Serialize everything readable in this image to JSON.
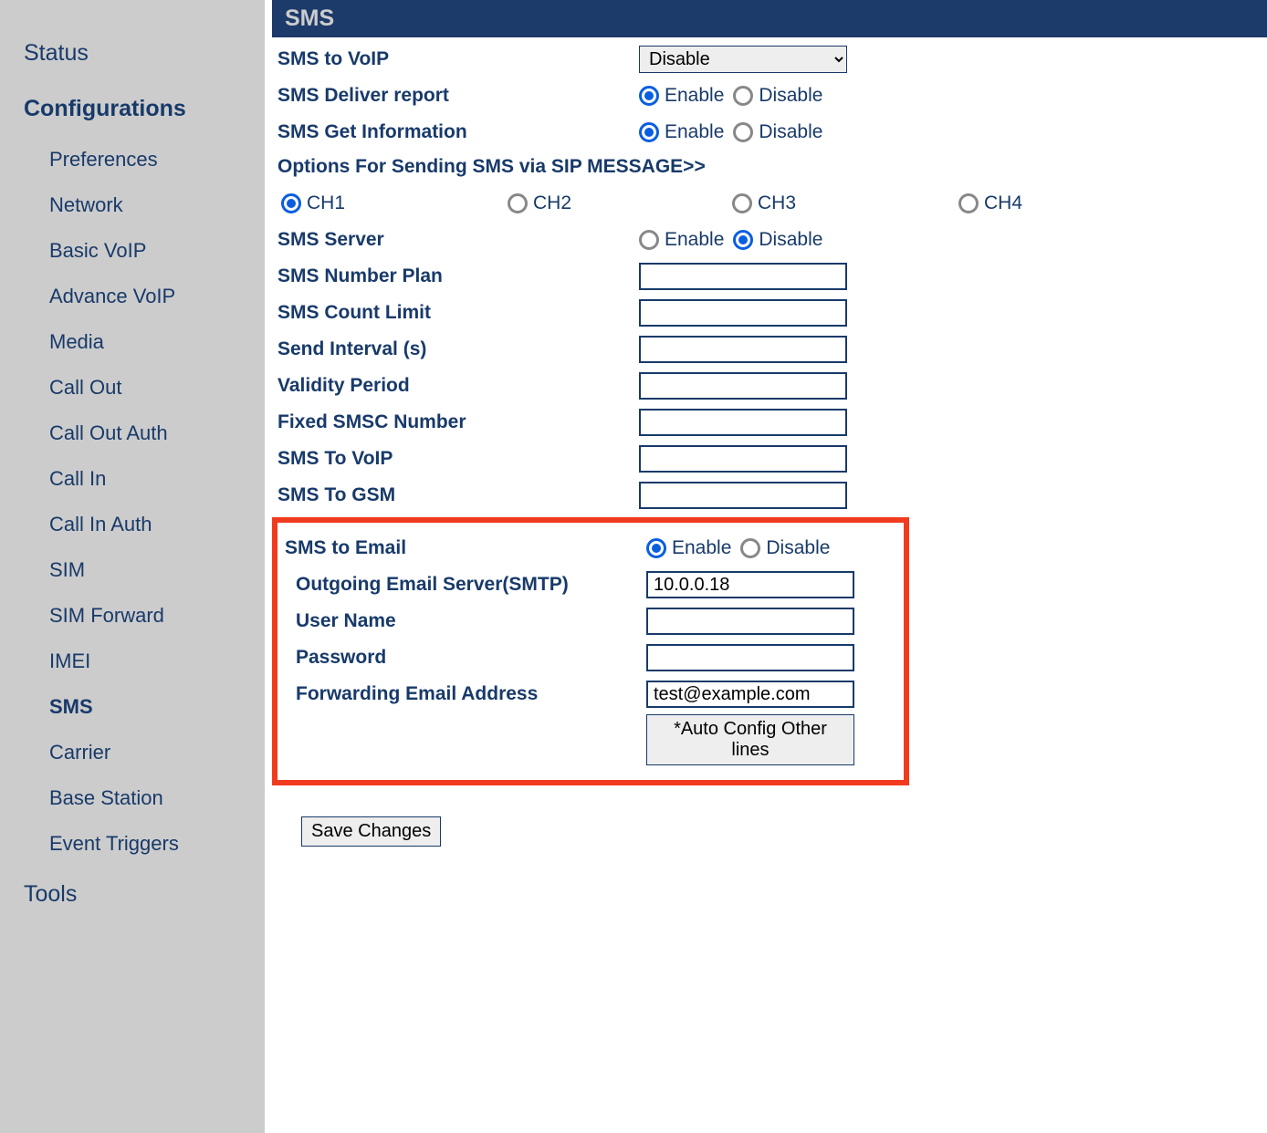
{
  "sidebar": {
    "topItems": [
      "Status",
      "Configurations",
      "Tools"
    ],
    "activeTop": "Configurations",
    "subItems": [
      "Preferences",
      "Network",
      "Basic VoIP",
      "Advance VoIP",
      "Media",
      "Call Out",
      "Call Out Auth",
      "Call In",
      "Call In Auth",
      "SIM",
      "SIM Forward",
      "IMEI",
      "SMS",
      "Carrier",
      "Base Station",
      "Event Triggers"
    ],
    "activeSub": "SMS"
  },
  "panel": {
    "title": "SMS",
    "smsToVoipLabel": "SMS to VoIP",
    "smsToVoipValue": "Disable",
    "smsDeliverLabel": "SMS Deliver report",
    "smsDeliver": "Enable",
    "smsGetInfoLabel": "SMS Get Information",
    "smsGetInfo": "Enable",
    "optionsLink": "Options For Sending SMS via SIP MESSAGE>>",
    "channels": [
      "CH1",
      "CH2",
      "CH3",
      "CH4"
    ],
    "channelSelected": "CH1",
    "smsServerLabel": "SMS Server",
    "smsServer": "Disable",
    "numberPlanLabel": "SMS Number Plan",
    "numberPlan": "",
    "countLimitLabel": "SMS Count Limit",
    "countLimit": "",
    "sendIntervalLabel": "Send Interval (s)",
    "sendInterval": "",
    "validityLabel": "Validity Period",
    "validity": "",
    "smscLabel": "Fixed SMSC Number",
    "smsc": "",
    "smsToVoip2Label": "SMS To VoIP",
    "smsToVoip2": "",
    "smsToGsmLabel": "SMS To GSM",
    "smsToGsm": "",
    "smsToEmailLabel": "SMS to Email",
    "smsToEmail": "Enable",
    "smtpLabel": "Outgoing Email Server(SMTP)",
    "smtp": "10.0.0.18",
    "userLabel": "User Name",
    "user": "",
    "passwordLabel": "Password",
    "password": "",
    "fwdEmailLabel": "Forwarding Email Address",
    "fwdEmail": "test@example.com",
    "autoConfigBtn": "*Auto Config Other lines",
    "saveBtn": "Save Changes",
    "enableLabel": "Enable",
    "disableLabel": "Disable"
  }
}
